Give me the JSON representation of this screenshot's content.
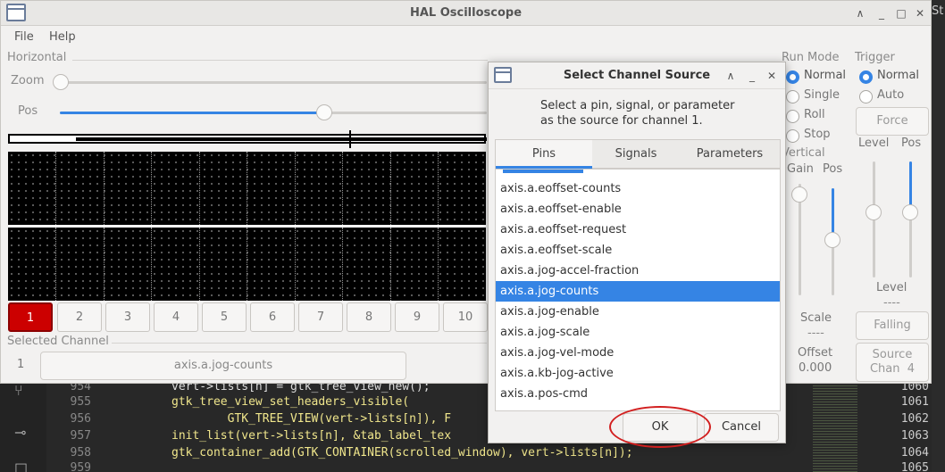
{
  "window": {
    "title": "HAL Oscilloscope",
    "controls": {
      "minimize_up": "∧",
      "minimize": "_",
      "maximize": "□",
      "close": "✕"
    }
  },
  "menu": {
    "file": "File",
    "help": "Help"
  },
  "horizontal": {
    "label": "Horizontal",
    "zoom_label": "Zoom",
    "pos_label": "Pos",
    "zoom_level": 0.0,
    "pos_level": 0.6
  },
  "channels": {
    "buttons": [
      "1",
      "2",
      "3",
      "4",
      "5",
      "6",
      "7",
      "8",
      "9",
      "10"
    ],
    "active": "1"
  },
  "selected_channel": {
    "label": "Selected Channel",
    "number": "1",
    "source": "axis.a.jog-counts"
  },
  "run_mode": {
    "label": "Run Mode",
    "options": [
      "Normal",
      "Single",
      "Roll",
      "Stop"
    ],
    "selected": "Normal"
  },
  "vertical": {
    "label": "Vertical",
    "gain_label": "Gain",
    "pos_label": "Pos",
    "scale_label": "Scale",
    "scale_value": "----",
    "offset_label": "Offset",
    "offset_value": "0.000"
  },
  "trigger": {
    "label": "Trigger",
    "options": [
      "Normal",
      "Auto"
    ],
    "selected": "Normal",
    "force_label": "Force",
    "level_label": "Level",
    "pos_label": "Pos",
    "level_caption": "Level",
    "level_value": "----",
    "edge_label": "Falling",
    "source_label": "Source",
    "source_value": "Chan  4"
  },
  "dialog": {
    "title": "Select Channel Source",
    "controls": {
      "up": "∧",
      "minimize": "_",
      "close": "✕"
    },
    "message_line1": "Select a pin, signal, or parameter",
    "message_line2": "as the source for channel 1.",
    "tabs": [
      "Pins",
      "Signals",
      "Parameters"
    ],
    "active_tab": "Pins",
    "items": [
      "axis.a.eoffset-counts",
      "axis.a.eoffset-enable",
      "axis.a.eoffset-request",
      "axis.a.eoffset-scale",
      "axis.a.jog-accel-fraction",
      "axis.a.jog-counts",
      "axis.a.jog-enable",
      "axis.a.jog-scale",
      "axis.a.jog-vel-mode",
      "axis.a.kb-jog-active",
      "axis.a.pos-cmd"
    ],
    "selected_item": "axis.a.jog-counts",
    "ok_label": "OK",
    "cancel_label": "Cancel"
  },
  "editor": {
    "lines": [
      {
        "num": "954",
        "code": "vert->lists[n] = gtk_tree_view_new();"
      },
      {
        "num": "955",
        "code": "gtk_tree_view_set_headers_visible("
      },
      {
        "num": "956",
        "code": "        GTK_TREE_VIEW(vert->lists[n]), F"
      },
      {
        "num": "957",
        "code": "init_list(vert->lists[n], &tab_label_tex"
      },
      {
        "num": "958",
        "code": "gtk_container_add(GTK_CONTAINER(scrolled_window), vert->lists[n]);"
      },
      {
        "num": "959",
        "code": ""
      }
    ],
    "right_numbers": [
      "1060",
      "1061",
      "1062",
      "1063",
      "1064",
      "1065"
    ],
    "right_top_text": "St"
  }
}
